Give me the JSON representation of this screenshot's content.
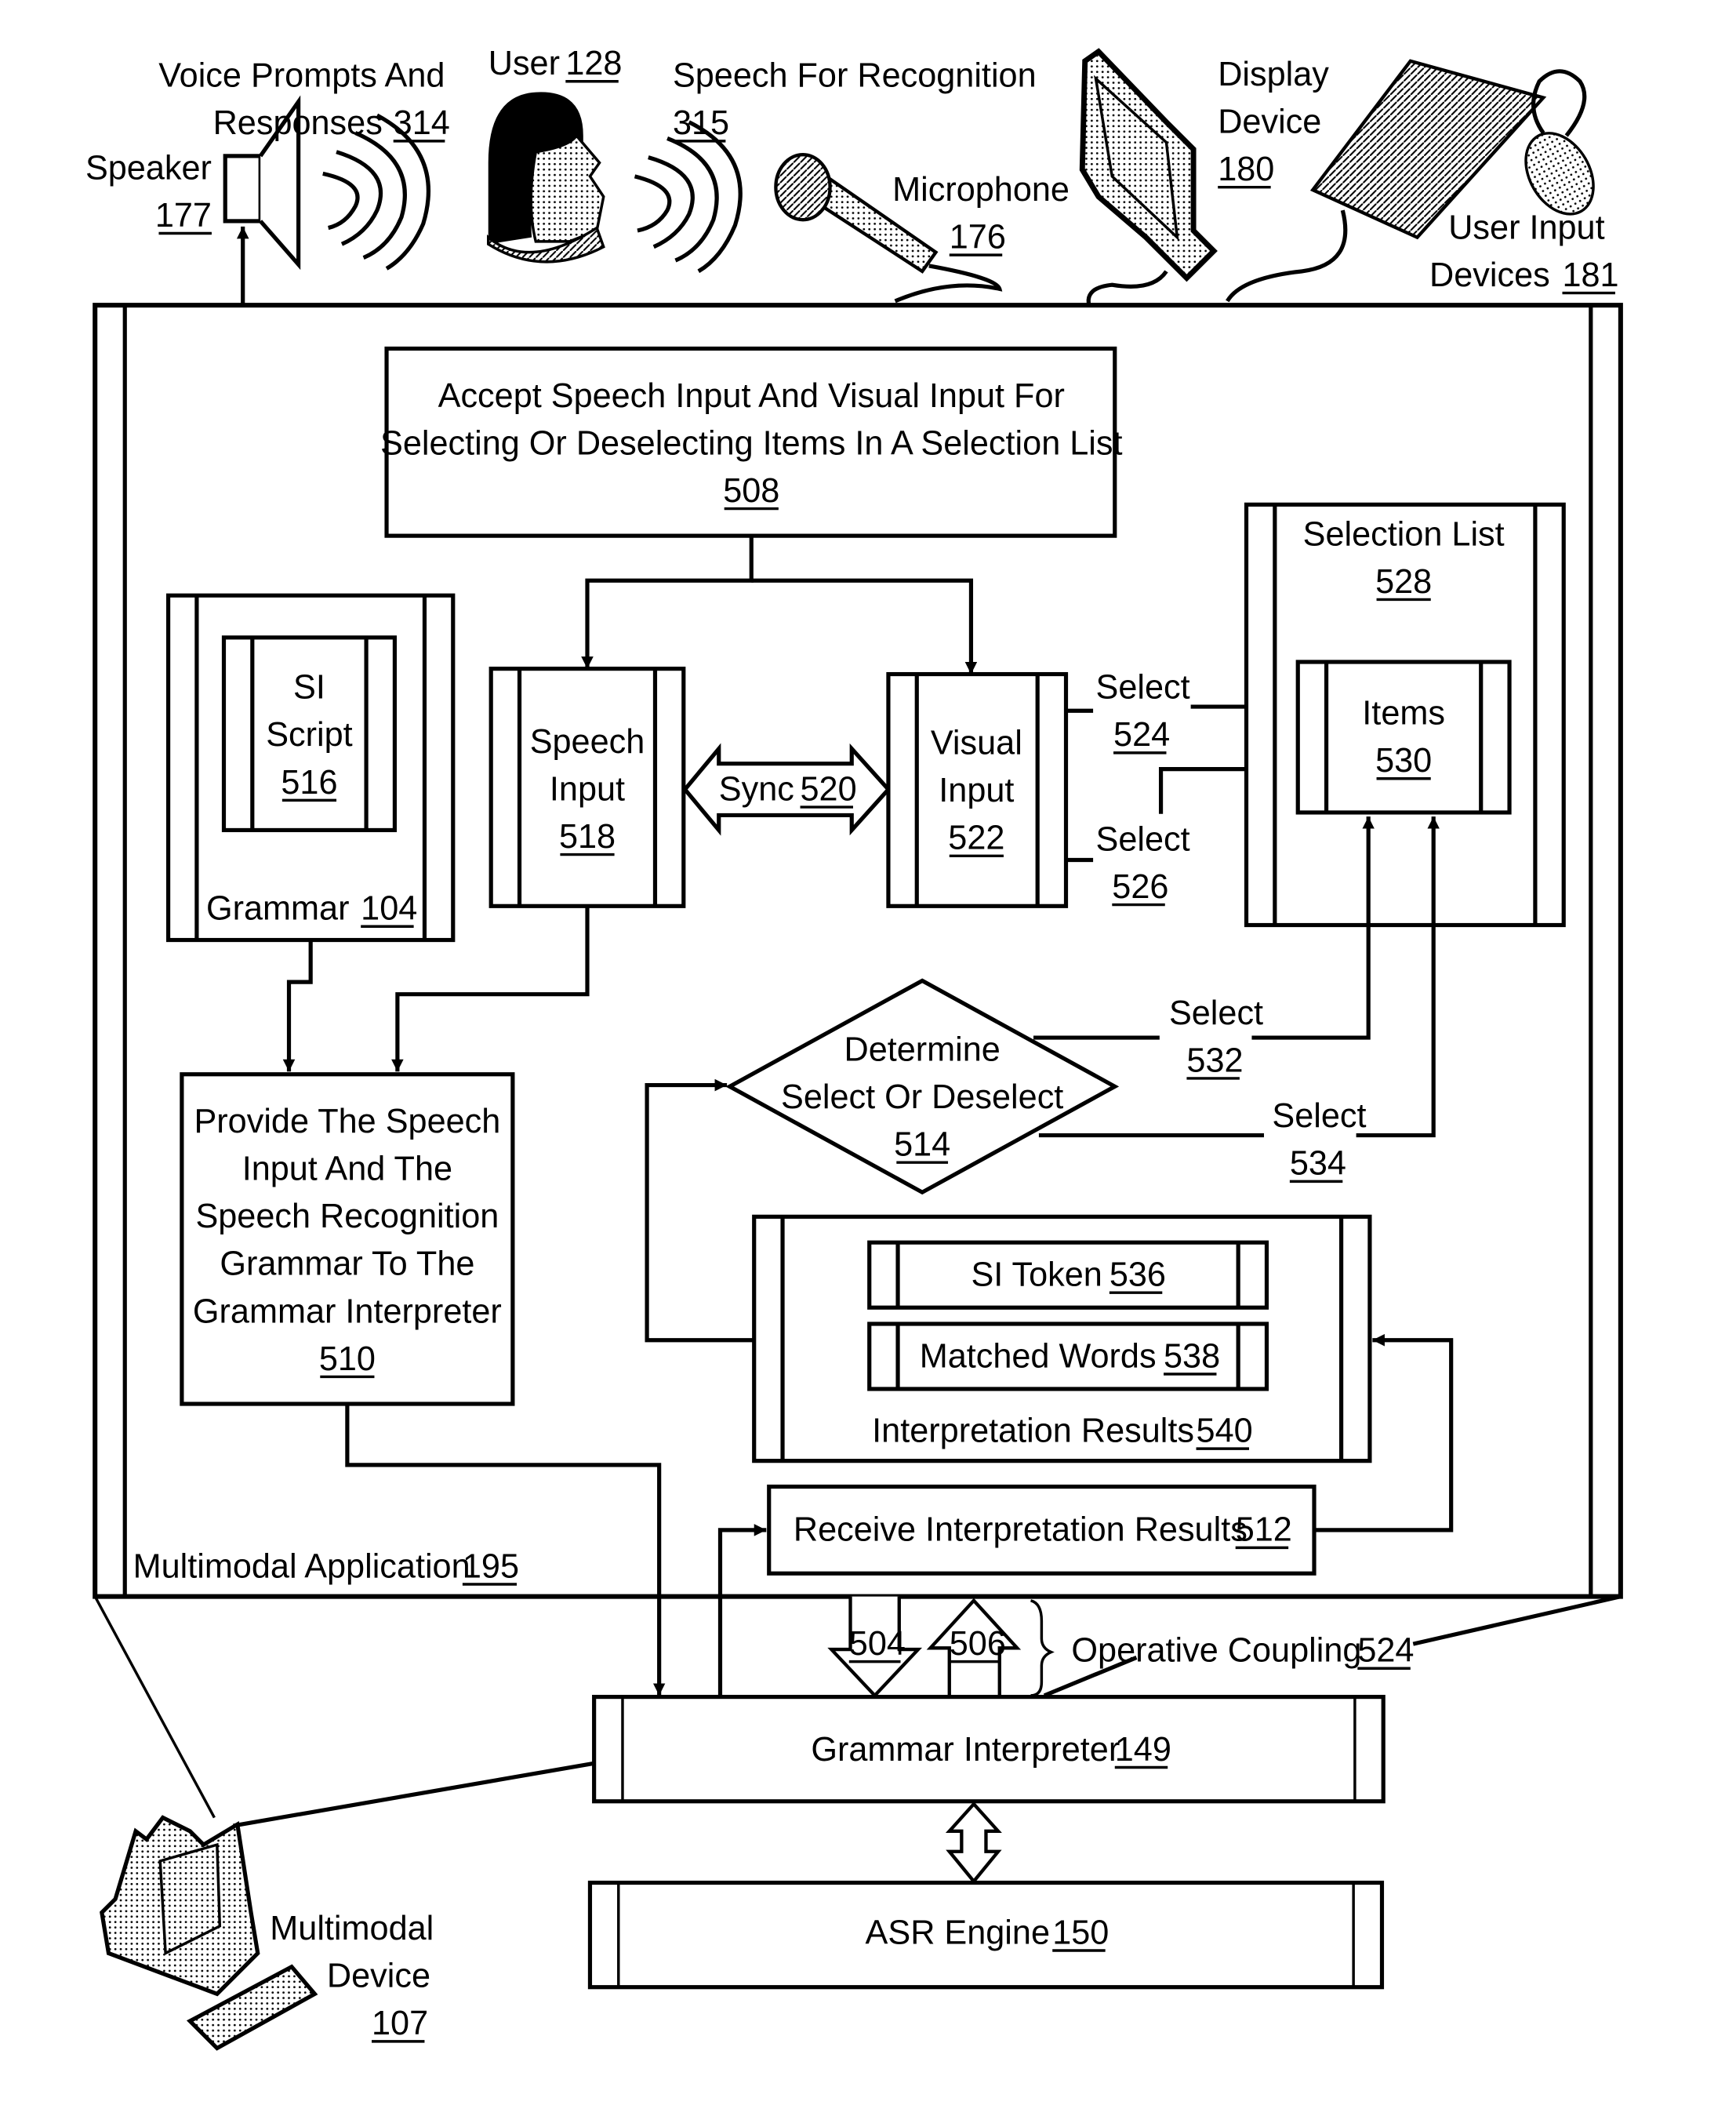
{
  "figure": {
    "peripherals": {
      "speaker": {
        "label": "Speaker",
        "ref": "177"
      },
      "voice_prompts": {
        "line1": "Voice Prompts And",
        "line2": "Responses",
        "ref": "314"
      },
      "user": {
        "label": "User",
        "ref": "128"
      },
      "speech_for_recognition": {
        "line1": "Speech For Recognition",
        "ref": "315"
      },
      "microphone": {
        "label": "Microphone",
        "ref": "176"
      },
      "display_device": {
        "line1": "Display",
        "line2": "Device",
        "ref": "180"
      },
      "user_input_devices": {
        "line1": "User Input",
        "line2": "Devices",
        "ref": "181"
      }
    },
    "application": {
      "label": "Multimodal Application",
      "ref": "195"
    },
    "step_508": {
      "line1": "Accept Speech Input And Visual Input For",
      "line2": "Selecting Or Deselecting Items In A Selection List",
      "ref": "508"
    },
    "grammar": {
      "label": "Grammar",
      "ref": "104"
    },
    "si_script": {
      "line1": "SI",
      "line2": "Script",
      "ref": "516"
    },
    "speech_input": {
      "line1": "Speech",
      "line2": "Input",
      "ref": "518"
    },
    "sync": {
      "label": "Sync",
      "ref": "520"
    },
    "visual_input": {
      "line1": "Visual",
      "line2": "Input",
      "ref": "522"
    },
    "select_524": {
      "label": "Select",
      "ref": "524"
    },
    "select_526": {
      "label": "Select",
      "ref": "526"
    },
    "selection_list": {
      "label": "Selection List",
      "ref": "528"
    },
    "items": {
      "label": "Items",
      "ref": "530"
    },
    "step_510": {
      "line1": "Provide The Speech",
      "line2": "Input And The",
      "line3": "Speech Recognition",
      "line4": "Grammar To The",
      "line5": "Grammar Interpreter",
      "ref": "510"
    },
    "step_514": {
      "line1": "Determine",
      "line2": "Select Or Deselect",
      "ref": "514"
    },
    "select_532": {
      "label": "Select",
      "ref": "532"
    },
    "select_534": {
      "label": "Select",
      "ref": "534"
    },
    "si_token": {
      "label": "SI Token",
      "ref": "536"
    },
    "matched_words": {
      "label": "Matched Words",
      "ref": "538"
    },
    "interpretation_results": {
      "label": "Interpretation Results",
      "ref": "540"
    },
    "step_512": {
      "label": "Receive Interpretation Results",
      "ref": "512"
    },
    "arrow_504": {
      "ref": "504"
    },
    "arrow_506": {
      "ref": "506"
    },
    "operative_coupling": {
      "label": "Operative Coupling",
      "ref": "524"
    },
    "grammar_interpreter": {
      "label": "Grammar Interpreter",
      "ref": "149"
    },
    "asr_engine": {
      "label": "ASR Engine",
      "ref": "150"
    },
    "multimodal_device": {
      "line1": "Multimodal",
      "line2": "Device",
      "ref": "107"
    }
  }
}
